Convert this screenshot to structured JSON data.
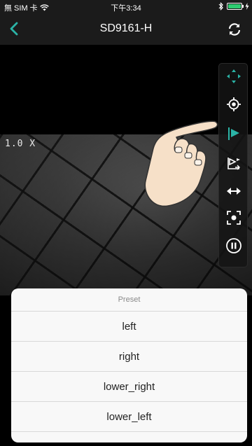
{
  "status_bar": {
    "carrier": "無 SIM 卡",
    "time": "下午3:34",
    "battery_level": 1.0,
    "icons": [
      "wifi-icon",
      "bluetooth-icon",
      "charging-icon"
    ]
  },
  "nav": {
    "title": "SD9161-H",
    "back_icon": "chevron-left-icon",
    "refresh_icon": "refresh-icon",
    "accent": "#2bb3a6"
  },
  "video": {
    "zoom_label": "1.0 X"
  },
  "toolbar": {
    "buttons": [
      "ptz-move-icon",
      "focus-target-icon",
      "preset-flag-icon",
      "tour-icon",
      "auto-pan-icon",
      "snapshot-icon",
      "pause-icon"
    ],
    "active": "preset-flag-icon"
  },
  "preset_sheet": {
    "title": "Preset",
    "options": [
      "left",
      "right",
      "lower_right",
      "lower_left"
    ]
  }
}
